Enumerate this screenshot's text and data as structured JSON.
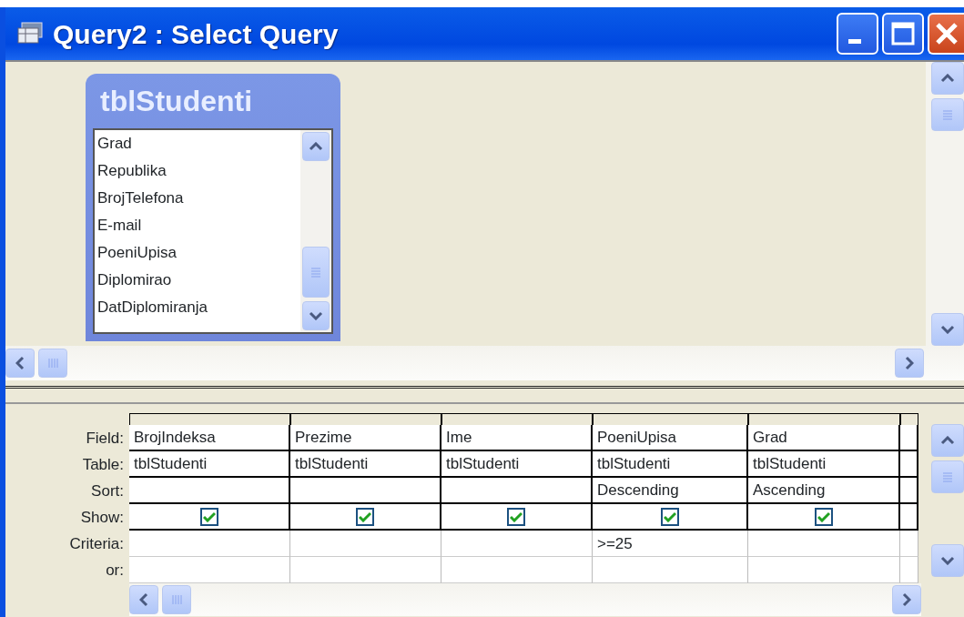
{
  "window": {
    "title": "Query2 : Select Query"
  },
  "field_list": {
    "title": "tblStudenti",
    "items": [
      "Grad",
      "Republika",
      "BrojTelefona",
      "E-mail",
      "PoeniUpisa",
      "Diplomirao",
      "DatDiplomiranja"
    ]
  },
  "grid": {
    "row_labels": [
      "Field:",
      "Table:",
      "Sort:",
      "Show:",
      "Criteria:",
      "or:"
    ],
    "columns": [
      {
        "field": "BrojIndeksa",
        "table": "tblStudenti",
        "show": true
      },
      {
        "field": "Prezime",
        "table": "tblStudenti",
        "show": true
      },
      {
        "field": "Ime",
        "table": "tblStudenti",
        "show": true
      },
      {
        "field": "PoeniUpisa",
        "table": "tblStudenti",
        "sort": "Descending",
        "show": true,
        "criteria": ">=25"
      },
      {
        "field": "Grad",
        "table": "tblStudenti",
        "sort": "Ascending",
        "show": true
      }
    ]
  }
}
